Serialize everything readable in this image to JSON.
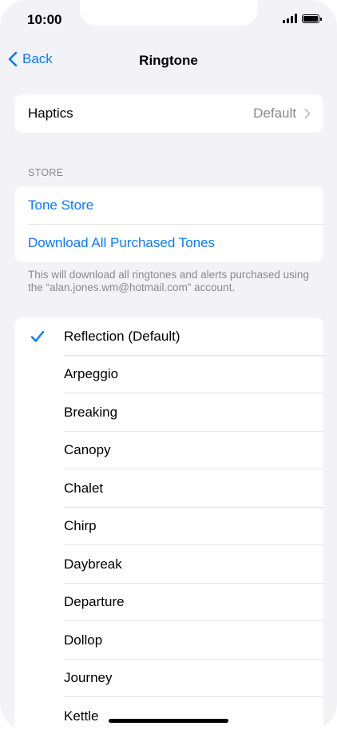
{
  "status": {
    "time": "10:00"
  },
  "nav": {
    "back_label": "Back",
    "title": "Ringtone"
  },
  "haptics": {
    "label": "Haptics",
    "value": "Default"
  },
  "store": {
    "header": "STORE",
    "tone_store": "Tone Store",
    "download_all": "Download All Purchased Tones",
    "note": "This will download all ringtones and alerts purchased using the “alan.jones.wm@hotmail.com” account."
  },
  "tones": {
    "selected_index": 0,
    "items": [
      "Reflection (Default)",
      "Arpeggio",
      "Breaking",
      "Canopy",
      "Chalet",
      "Chirp",
      "Daybreak",
      "Departure",
      "Dollop",
      "Journey",
      "Kettle"
    ]
  },
  "colors": {
    "accent": "#0a7aff",
    "background": "#f2f2f7",
    "secondary_text": "#8a8a8e"
  }
}
